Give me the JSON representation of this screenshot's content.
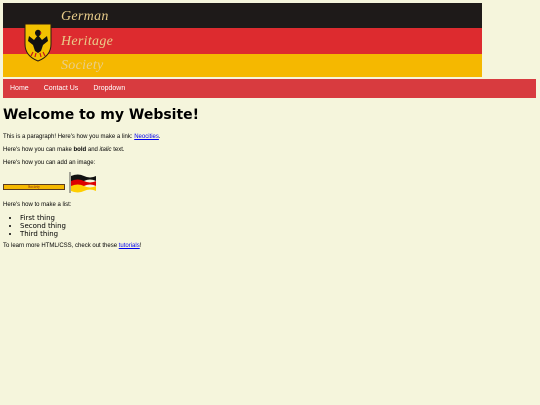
{
  "header": {
    "banner_lines": [
      "German",
      "Heritage",
      "Society"
    ],
    "colors": {
      "black": "#1e1a19",
      "red": "#dd2b2f",
      "gold": "#f5b800"
    },
    "logo_icon": "eagle-coat-of-arms-icon"
  },
  "nav": {
    "items": [
      "Home",
      "Contact Us",
      "Dropdown"
    ],
    "background": "#d83b3f"
  },
  "main": {
    "heading": "Welcome to my Website!",
    "p1_prefix": "This is a paragraph! Here's how you make a link: ",
    "p1_link": "Neocities",
    "p1_suffix": ".",
    "p2_prefix": "Here's how you can make ",
    "p2_bold": "bold",
    "p2_middle": " and ",
    "p2_italic": "italic",
    "p2_suffix": " text.",
    "p3": "Here's how you can add an image:",
    "image_banner_text": "Society",
    "image_flag_icon": "german-flag-icon",
    "p4": "Here's how to make a list:",
    "list": [
      "First thing",
      "Second thing",
      "Third thing"
    ],
    "p5_prefix": "To learn more HTML/CSS, check out these ",
    "p5_link": "tutorials",
    "p5_suffix": "!"
  },
  "page_background": "#f5f5dc"
}
